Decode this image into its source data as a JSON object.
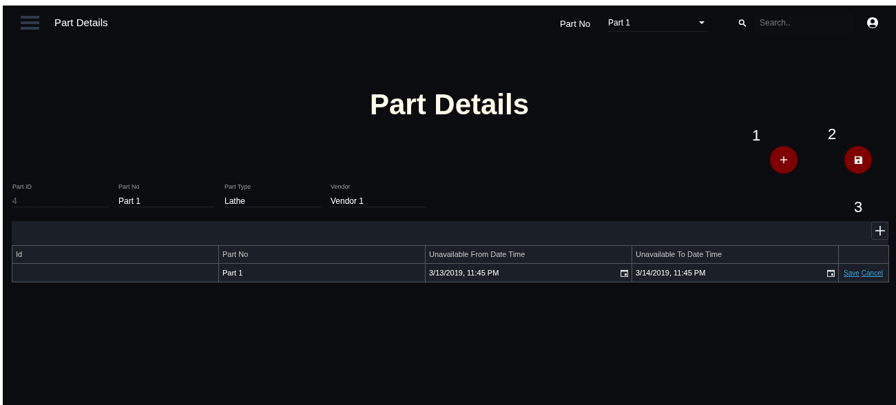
{
  "header": {
    "title": "Part Details",
    "part_no_label": "Part No",
    "part_no_value": "Part 1",
    "search": {
      "placeholder": "Search.."
    }
  },
  "page_title": "Part Details",
  "callouts": [
    "1",
    "2",
    "3"
  ],
  "fields": [
    {
      "label": "Part ID",
      "value": "4",
      "disabled": true
    },
    {
      "label": "Part No",
      "value": "Part 1",
      "disabled": false
    },
    {
      "label": "Part Type",
      "value": "Lathe",
      "disabled": false
    },
    {
      "label": "Vendor",
      "value": "Vendor 1",
      "disabled": false
    }
  ],
  "table": {
    "columns": [
      "Id",
      "Part No",
      "Unavailable From Date Time",
      "Unavailable To Date Time"
    ],
    "rows": [
      {
        "cells": [
          {
            "kind": "empty"
          },
          {
            "kind": "text",
            "value": "Part 1"
          },
          {
            "kind": "date",
            "value": "3/13/2019, 11:45 PM"
          },
          {
            "kind": "date",
            "value": "3/14/2019, 11:45 PM"
          }
        ],
        "actions": [
          "Save",
          "Cancel"
        ]
      }
    ]
  }
}
